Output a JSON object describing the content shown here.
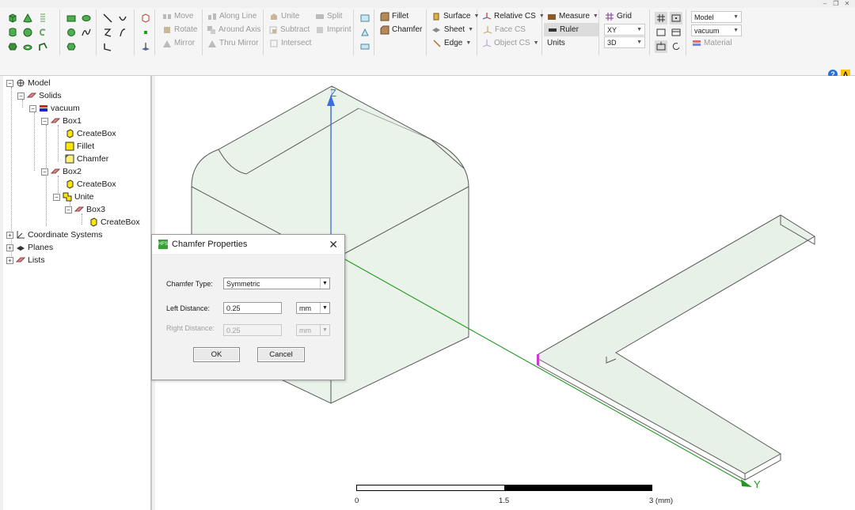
{
  "window": {
    "controls": [
      "–",
      "❐",
      "✕"
    ]
  },
  "ribbon": {
    "move": "Move",
    "rotate": "Rotate",
    "mirror": "Mirror",
    "along_line": "Along Line",
    "around_axis": "Around Axis",
    "thru_mirror": "Thru Mirror",
    "unite": "Unite",
    "subtract": "Subtract",
    "intersect": "Intersect",
    "split": "Split",
    "imprint": "Imprint",
    "fillet": "Fillet",
    "chamfer": "Chamfer",
    "surface": "Surface",
    "sheet": "Sheet",
    "edge": "Edge",
    "relative_cs": "Relative CS",
    "face_cs": "Face CS",
    "object_cs": "Object CS",
    "measure": "Measure",
    "ruler": "Ruler",
    "units": "Units",
    "grid": "Grid",
    "plane_value": "XY",
    "mode_value": "3D",
    "model_value": "Model",
    "material_value": "vacuum",
    "material_label": "Material"
  },
  "tree": {
    "model": "Model",
    "solids": "Solids",
    "vacuum": "vacuum",
    "box1": "Box1",
    "box1_create": "CreateBox",
    "box1_fillet": "Fillet",
    "box1_chamfer": "Chamfer",
    "box2": "Box2",
    "box2_create": "CreateBox",
    "unite": "Unite",
    "box3": "Box3",
    "box3_create": "CreateBox",
    "coord_systems": "Coordinate Systems",
    "planes": "Planes",
    "lists": "Lists"
  },
  "viewport": {
    "axis_z": "Z",
    "axis_y": "Y",
    "scale": {
      "start": "0",
      "mid": "1.5",
      "end": "3 (mm)"
    }
  },
  "dialog": {
    "title": "Chamfer Properties",
    "chamfer_type_label": "Chamfer Type:",
    "chamfer_type_value": "Symmetric",
    "left_distance_label": "Left Distance:",
    "left_distance_value": "0.25",
    "left_unit": "mm",
    "right_distance_label": "Right Distance:",
    "right_distance_value": "0.25",
    "right_unit": "mm",
    "ok": "OK",
    "cancel": "Cancel"
  },
  "colors": {
    "solid_fill": "#e3efe3",
    "solid_edge": "#5a5a5a",
    "axis_z": "#3b6fe0",
    "axis_y": "#1f9a1f"
  }
}
